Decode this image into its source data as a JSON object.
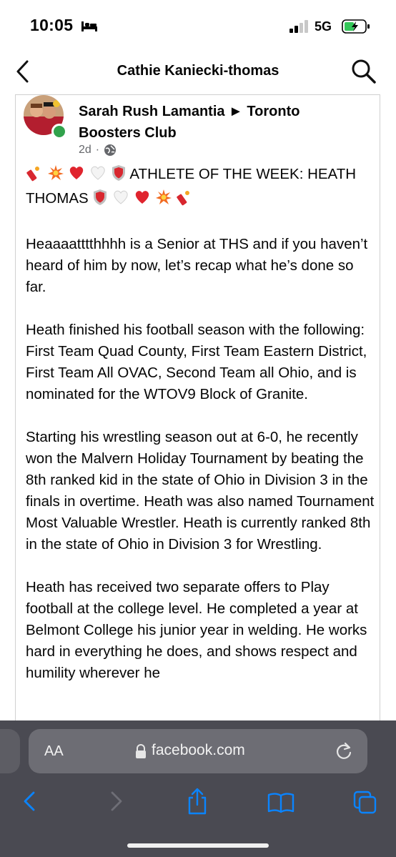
{
  "status": {
    "time": "10:05",
    "network": "5G"
  },
  "header": {
    "title": "Cathie Kaniecki-thomas"
  },
  "post": {
    "author": "Sarah Rush Lamantia ► Toronto Boosters Club",
    "time": "2d",
    "headline_text": "ATHLETE OF THE WEEK: HEATH THOMAS",
    "paragraphs": [
      "Heaaaatttthhhh is a Senior at THS and if you haven’t heard of him by now, let’s recap what he’s done so far.",
      "Heath finished his football season with the following: First Team Quad County,  First Team Eastern District, First Team All OVAC, Second Team all Ohio, and is nominated for the WTOV9 Block of Granite.",
      "Starting his wrestling season out at 6-0, he recently won the Malvern Holiday Tournament by beating the 8th ranked kid in the state of Ohio in Division 3 in the finals in overtime. Heath was also named Tournament Most Valuable Wrestler.  Heath is currently ranked 8th in the state of Ohio in Division 3 for Wrestling.",
      "Heath has received two separate offers to Play football at the college level. He completed a year at Belmont College his junior year in welding. He works hard in everything he does, and shows respect and humility wherever he"
    ]
  },
  "browser": {
    "text_size_label": "AA",
    "url": "facebook.com"
  },
  "colors": {
    "online": "#31a24c",
    "ios_blue": "#0a84ff",
    "toolbar": "#4a4a52"
  }
}
